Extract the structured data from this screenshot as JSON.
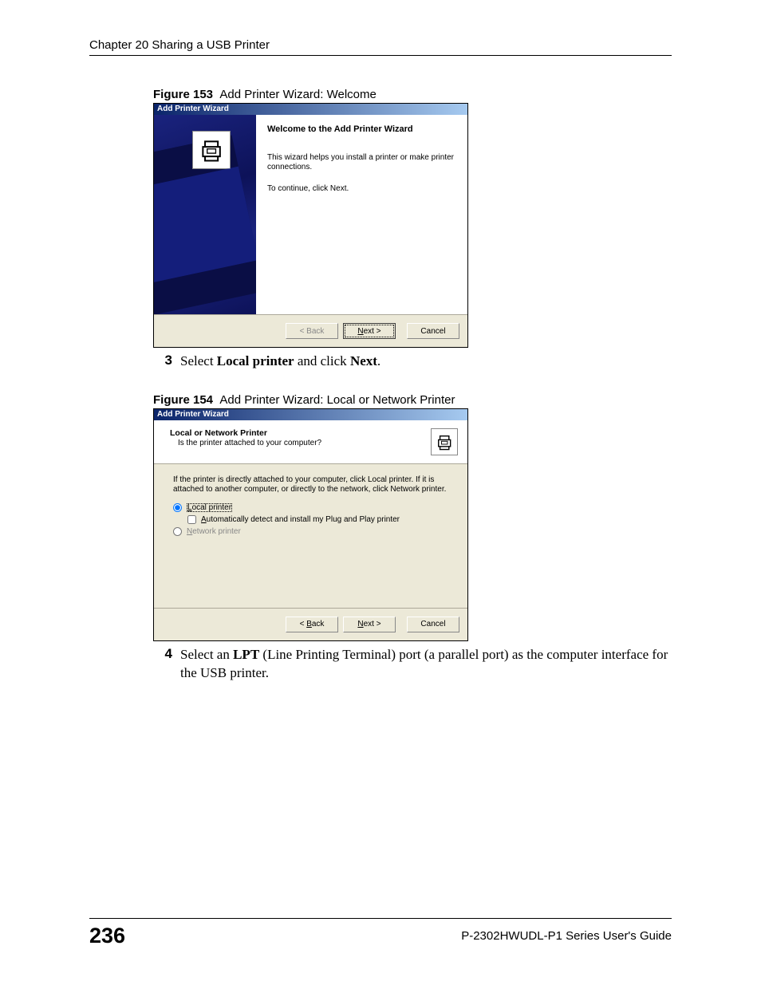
{
  "header": {
    "chapter": "Chapter 20 Sharing a USB Printer"
  },
  "figure153": {
    "label": "Figure 153",
    "title": "Add Printer Wizard: Welcome"
  },
  "wizard1": {
    "title": "Add Printer Wizard",
    "heading": "Welcome to the Add Printer Wizard",
    "line1": "This wizard helps you install a printer or make printer connections.",
    "line2": "To continue, click Next.",
    "buttons": {
      "back": "< Back",
      "next_pre": "N",
      "next_post": "ext >",
      "cancel": "Cancel"
    }
  },
  "step3": {
    "num": "3",
    "pre": "Select ",
    "bold1": "Local printer",
    "mid": " and click ",
    "bold2": "Next",
    "post": "."
  },
  "figure154": {
    "label": "Figure 154",
    "title": "Add Printer Wizard: Local or Network Printer"
  },
  "wizard2": {
    "title": "Add Printer Wizard",
    "hdr_title": "Local or Network Printer",
    "hdr_sub": "Is the printer attached to your computer?",
    "instr": "If the printer is directly attached to your computer, click Local printer. If it is attached to another computer, or directly to the network, click Network printer.",
    "opt_local_u": "L",
    "opt_local_rest": "ocal printer",
    "opt_auto_u": "A",
    "opt_auto_rest": "utomatically detect and install my Plug and Play printer",
    "opt_net_u": "N",
    "opt_net_rest": "etwork printer",
    "buttons": {
      "back_u": "B",
      "back_rest": "ack",
      "next_u": "N",
      "next_rest": "ext >",
      "cancel": "Cancel"
    }
  },
  "step4": {
    "num": "4",
    "pre": "Select an ",
    "bold1": "LPT",
    "post": " (Line Printing Terminal) port (a parallel port) as the computer interface for the USB printer."
  },
  "footer": {
    "page": "236",
    "guide": "P-2302HWUDL-P1 Series User's Guide"
  }
}
